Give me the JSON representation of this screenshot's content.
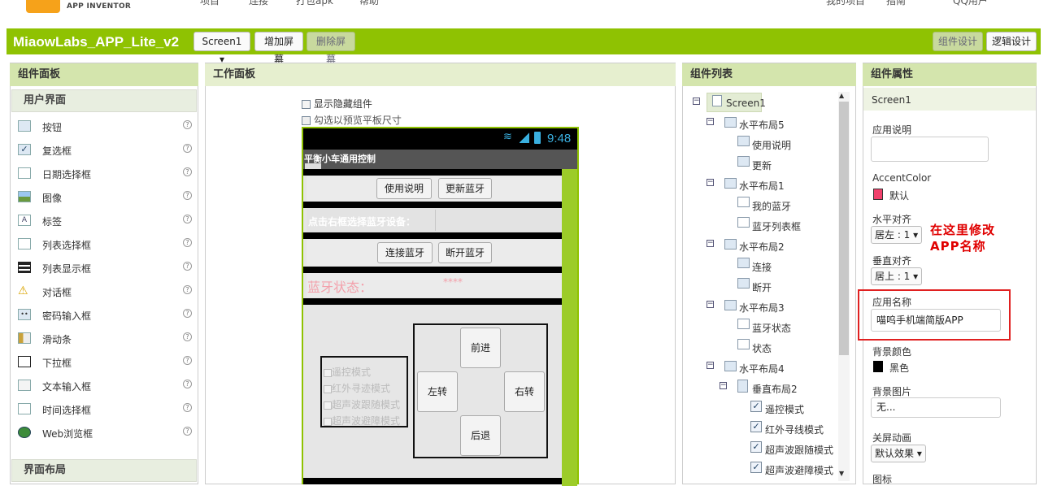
{
  "topnav": {
    "logo_text": "APP INVENTOR",
    "items": [
      "项目",
      "连接",
      "打包apk",
      "帮助"
    ],
    "right_items": [
      "我的项目",
      "指南",
      "QQ用户"
    ]
  },
  "project": {
    "title": "MiaowLabs_APP_Lite_v2",
    "screen_select": "Screen1 ▾",
    "add_screen": "增加屏幕",
    "remove_screen": "删除屏幕",
    "designer": "组件设计",
    "blocks": "逻辑设计"
  },
  "palette": {
    "header": "组件面板",
    "section_ui": "用户界面",
    "items": [
      "按钮",
      "复选框",
      "日期选择框",
      "图像",
      "标签",
      "列表选择框",
      "列表显示框",
      "对话框",
      "密码输入框",
      "滑动条",
      "下拉框",
      "文本输入框",
      "时间选择框",
      "Web浏览框"
    ],
    "section_layout": "界面布局",
    "help": "?"
  },
  "viewer": {
    "header": "工作面板",
    "show_hidden": "显示隐藏组件",
    "tablet_preview": "勾选以预览平板尺寸",
    "status_time": "9:48",
    "app_title": "平衡小车通用控制",
    "btn_instructions": "使用说明",
    "btn_update_bt": "更新蓝牙",
    "select_device": "点击右框选择蓝牙设备：",
    "btn_connect": "连接蓝牙",
    "btn_disconnect": "断开蓝牙",
    "bt_status_label": "蓝牙状态：",
    "bt_status_value": "****",
    "modes": [
      "遥控模式",
      "红外寻迹模式",
      "超声波跟随模式",
      "超声波避障模式"
    ],
    "dir_forward": "前进",
    "dir_left": "左转",
    "dir_right": "右转",
    "dir_back": "后退"
  },
  "components": {
    "header": "组件列表",
    "tree": {
      "screen": "Screen1",
      "h5": "水平布局5",
      "h5_a": "使用说明",
      "h5_b": "更新",
      "h1": "水平布局1",
      "h1_a": "我的蓝牙",
      "h1_b": "蓝牙列表框",
      "h2": "水平布局2",
      "h2_a": "连接",
      "h2_b": "断开",
      "h3": "水平布局3",
      "h3_a": "蓝牙状态",
      "h3_b": "状态",
      "h4": "水平布局4",
      "v2": "垂直布局2",
      "c1": "遥控模式",
      "c2": "红外寻线模式",
      "c3": "超声波跟随模式",
      "c4": "超声波避障模式"
    }
  },
  "properties": {
    "header": "组件属性",
    "component": "Screen1",
    "about_label": "应用说明",
    "accent_label": "AccentColor",
    "accent_value": "默认",
    "accent_color": "#f1416c",
    "halign_label": "水平对齐",
    "halign_value": "居左 : 1 ▾",
    "valign_label": "垂直对齐",
    "valign_value": "居上 : 1 ▾",
    "appname_label": "应用名称",
    "appname_value": "喵呜手机端简版APP",
    "bgcolor_label": "背景颜色",
    "bgcolor_value": "黑色",
    "bgimage_label": "背景图片",
    "bgimage_value": "无...",
    "close_anim_label": "关屏动画",
    "close_anim_value": "默认效果 ▾",
    "icon_label": "图标"
  },
  "annotation": {
    "text": "在这里修改APP名称",
    "color": "#e00000"
  }
}
